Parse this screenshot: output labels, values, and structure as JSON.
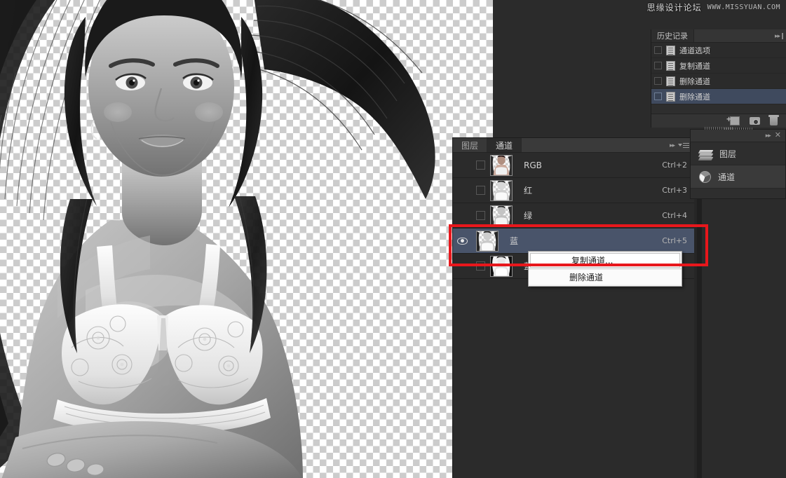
{
  "watermark": {
    "cn": "思缘设计论坛",
    "en": "WWW.MISSYUAN.COM"
  },
  "history_panel": {
    "tab_label": "历史记录",
    "items": [
      {
        "label": "通道选项",
        "selected": false
      },
      {
        "label": "复制通道",
        "selected": false
      },
      {
        "label": "删除通道",
        "selected": false
      },
      {
        "label": "删除通道",
        "selected": true
      }
    ],
    "footer_icons": [
      {
        "name": "new-document-icon"
      },
      {
        "name": "snapshot-camera-icon"
      },
      {
        "name": "delete-trash-icon"
      }
    ]
  },
  "right_dock": {
    "items": [
      {
        "label": "图层",
        "icon": "layers-icon",
        "selected": false
      },
      {
        "label": "通道",
        "icon": "channels-icon",
        "selected": true
      }
    ],
    "close_glyph": "✕",
    "expand_glyph": "▸▸"
  },
  "channels_panel": {
    "tabs": [
      {
        "label": "图层",
        "active": false
      },
      {
        "label": "通道",
        "active": true
      }
    ],
    "expand_glyph": "▸▸",
    "channels": [
      {
        "name": "RGB",
        "shortcut": "Ctrl+2",
        "visible": false,
        "selected": false
      },
      {
        "name": "红",
        "shortcut": "Ctrl+3",
        "visible": false,
        "selected": false
      },
      {
        "name": "绿",
        "shortcut": "Ctrl+4",
        "visible": false,
        "selected": false
      },
      {
        "name": "蓝",
        "shortcut": "Ctrl+5",
        "visible": true,
        "selected": true
      },
      {
        "name": "蓝 拷贝",
        "shortcut": "",
        "visible": false,
        "selected": false
      }
    ]
  },
  "context_menu": {
    "items": [
      {
        "label": "复制通道...",
        "highlighted": true
      },
      {
        "label": "删除通道",
        "highlighted": false
      }
    ]
  },
  "colors": {
    "annotation_red": "#e8171c",
    "selection_blue": "#49546a",
    "panel_bg": "#2b2b2b",
    "workspace_bg": "#2b2b2b"
  }
}
